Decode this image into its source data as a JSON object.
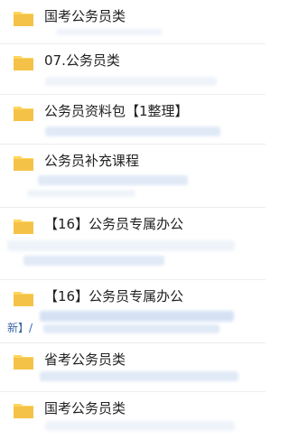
{
  "colors": {
    "folder_main": "#f5c248",
    "folder_tab": "#ffd65e",
    "blur_blue": "#dfe8f6",
    "divider": "#ececec",
    "link_fragment": "#3d67a6"
  },
  "items": [
    {
      "label": "国考公务员类",
      "icon": "folder-icon"
    },
    {
      "label": "07.公务员类",
      "icon": "folder-icon"
    },
    {
      "label": "公务员资料包【1整理】",
      "icon": "folder-icon"
    },
    {
      "label": "公务员补充课程",
      "icon": "folder-icon"
    },
    {
      "label": "【16】公务员专属办公",
      "icon": "folder-icon"
    },
    {
      "label": "【16】公务员专属办公",
      "icon": "folder-icon"
    },
    {
      "label": "省考公务员类",
      "icon": "folder-icon"
    },
    {
      "label": "国考公务员类",
      "icon": "folder-icon"
    }
  ],
  "visible_fragment": "新】/"
}
